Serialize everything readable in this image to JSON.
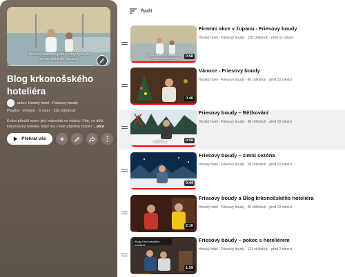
{
  "playlist": {
    "cover_caption": "Prvním okamem jedné firmy bylo, že se převlékli do županu.",
    "title": "Blog krkonošského hoteliéra",
    "owner": "autor: Horský hotel - Friesovy boudy",
    "meta": "Playlist · Veřejné · 6 videí · 119 zhlédnutí",
    "description": "Kniha přináší mimo jiné odpovědi na otázky: Víte, co dělá krkonošský hoteliér, když mu v létě přijedou hosté?",
    "more": "...více",
    "play_all": "Přehrát vše",
    "icons": {
      "cover_edit": "pencil-icon",
      "play": "play-icon",
      "add": "plus-icon",
      "edit": "pencil-icon",
      "share": "share-icon",
      "more": "more-vert-icon"
    },
    "colors": {
      "panel_top": "#7a6e62",
      "panel_bottom": "#5d544b"
    }
  },
  "sort": {
    "label": "Řadit",
    "icon": "sort-icon"
  },
  "videos": [
    {
      "title": "Firemní akce v županu - Friesovy boudy",
      "meta": "Horský hotel - Friesovy boudy · 128 zhlédnutí · před 11 měsíci",
      "duration": "0:58",
      "caption": "Prvním okamem jedné firmy bylo, že se převlékli do županu.",
      "watched": 1
    },
    {
      "title": "Vánoce - Friesovy boudy",
      "meta": "Horský hotel - Friesovy boudy · 86 zhlédnutí · před 10 měsíci",
      "duration": "0:46",
      "caption": "",
      "watched": 1
    },
    {
      "title": "Friesovy boudy – Běžkování",
      "meta": "Horský hotel - Friesovy boudy · 38 zhlédnutí · před 10 měsíci",
      "duration": "0:58",
      "caption": "velikost aj.",
      "watched": 1
    },
    {
      "title": "Friesovy boudy – zimní sezóna",
      "meta": "Horský hotel - Friesovy boudy · 99 zhlédnutí · před 10 měsíci",
      "duration": "0:44",
      "caption": "",
      "watched": 1
    },
    {
      "title": "Friesovy boudy a Blog krkonošského hoteliéra",
      "meta": "Horský hotel - Friesovy boudy · 90 zhlédnutí · před 10 měsíci",
      "duration": "2:10",
      "caption": "",
      "watched": 0.1
    },
    {
      "title": "Friesovy boudy – pokec s hoteliérem",
      "meta": "Horský hotel - Friesovy boudy · 121 zhlédnutí · před 2 měsíci",
      "duration": "1:59",
      "caption": "Blogy Krkonošského hoteliéra",
      "watched": 0.3
    }
  ]
}
